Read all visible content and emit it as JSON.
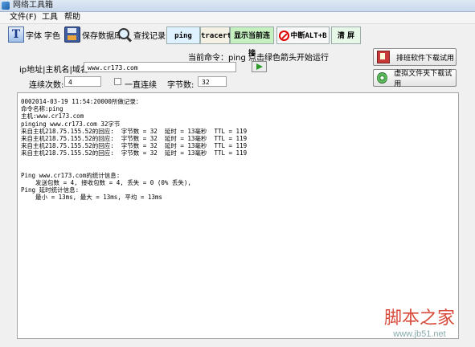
{
  "window": {
    "title": "网络工具箱"
  },
  "menu": [
    "文件(F)",
    "工具",
    "帮助"
  ],
  "toolbar": {
    "font_label": "字体",
    "color_label": "字色",
    "save_label": "保存数据库",
    "search_label": "查找记录",
    "ping_label": "ping",
    "tracert_label": "tracert",
    "show_conn_label": "显示当前连接",
    "stop_label": "中断ALT+B",
    "clear_label": "清 屏"
  },
  "form": {
    "status": "当前命令：ping 点击绿色箭头开始运行",
    "host_label": "ip地址|主机名|域名:",
    "host_value": "www.cr173.com",
    "count_label": "连续次数:",
    "count_value": "4",
    "continuous_label": "一直连续",
    "bytes_label": "字节数:",
    "bytes_value": "32"
  },
  "side_buttons": {
    "download_sorted": "排班软件下载试用",
    "virtual_folder": "虚拟文件夹下载试用"
  },
  "output": {
    "lines": [
      "0002014-03-19 11:54:20000所做记录：",
      "命令名称:ping",
      "主机:www.cr173.com",
      "pinging www.cr173.com 32字节",
      "来自主机218.75.155.52的回应:  字节数 = 32  延时 = 13毫秒  TTL = 119",
      "来自主机218.75.155.52的回应:  字节数 = 32  延时 = 13毫秒  TTL = 119",
      "来自主机218.75.155.52的回应:  字节数 = 32  延时 = 13毫秒  TTL = 119",
      "来自主机218.75.155.52的回应:  字节数 = 32  延时 = 13毫秒  TTL = 119",
      "",
      "",
      "Ping www.cr173.com的统计信息:",
      "    发送包数 = 4, 接收包数 = 4, 丢失 = 0 (0% 丢失),",
      "Ping 延时统计信息:",
      "    最小 = 13ms, 最大 = 13ms, 平均 = 13ms"
    ]
  },
  "watermark": {
    "main": "脚本之家",
    "sub": "www.jb51.net"
  },
  "colors": {
    "ping_bg": "#dff2ff",
    "tracert_bg": "#f4f0e4",
    "show_conn_bg": "#c6f0c0",
    "clear_bg": "#e8f8e8",
    "run_arrow": "#2a9b2a"
  }
}
